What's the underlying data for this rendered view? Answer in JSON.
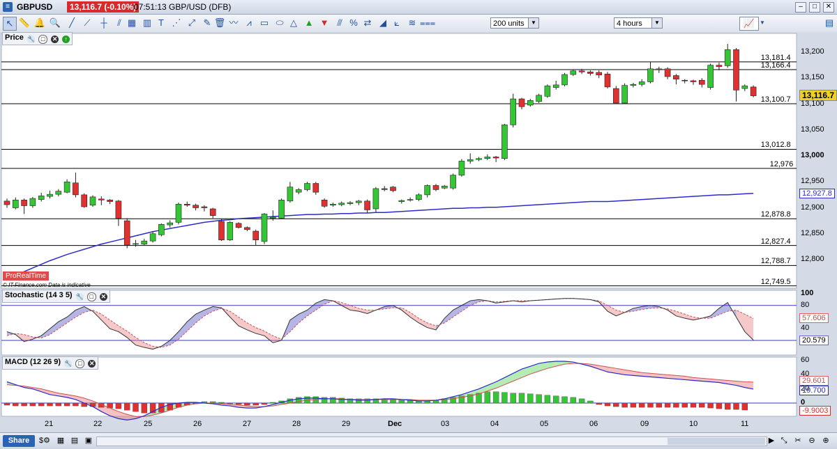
{
  "titlebar": {
    "symbol": "GBPUSD",
    "price": "13,116.7 (-0.10%)",
    "info": "07:51:13 GBP/USD (DFB)",
    "minimize": "–",
    "maximize": "□",
    "close": "✕"
  },
  "toolbar": {
    "units": "200 units",
    "timeframe": "4 hours"
  },
  "panels": {
    "price": {
      "label": "Price"
    },
    "stochastic": {
      "label": "Stochastic (14 3 5)"
    },
    "macd": {
      "label": "MACD (12 26 9)"
    }
  },
  "price_axis": [
    "13,200",
    "13,150",
    "13,100",
    "13,050",
    "13,000",
    "12,950",
    "12,900",
    "12,850",
    "12,800"
  ],
  "levels": [
    "13,181.4",
    "13,166.4",
    "13,100.7",
    "13,012.8",
    "12,976",
    "12,878.8",
    "12,827.4",
    "12,788.7",
    "12,749.5"
  ],
  "badges": {
    "last": "13,116.7",
    "ma": "12,927.8",
    "stoch_sig": "57.606",
    "stoch_k": "20.579",
    "macd1": "29.601",
    "macd2": "19.700",
    "macd3": "-9.9003"
  },
  "stoch_axis": [
    "100",
    "80",
    "40"
  ],
  "macd_axis": [
    "60",
    "40",
    "20",
    "0"
  ],
  "xlabels": [
    "21",
    "22",
    "25",
    "26",
    "27",
    "28",
    "29",
    "Dec",
    "03",
    "04",
    "05",
    "06",
    "09",
    "10",
    "11"
  ],
  "watermark": {
    "brand": "ProRealTime",
    "credit": "© IT-Finance.com  Data is indicative"
  },
  "status": {
    "share": "Share"
  },
  "colors": {
    "up": "#35c635",
    "down": "#e03030",
    "ma": "#2b2bcc",
    "level": "#000000"
  },
  "chart_data": {
    "type": "candlestick",
    "ylim": [
      12740,
      13220
    ],
    "candles": [
      {
        "o": 12913,
        "c": 12906,
        "h": 12918,
        "l": 12900
      },
      {
        "o": 12900,
        "c": 12915,
        "h": 12920,
        "l": 12897
      },
      {
        "o": 12915,
        "c": 12904,
        "h": 12918,
        "l": 12888
      },
      {
        "o": 12904,
        "c": 12918,
        "h": 12921,
        "l": 12900
      },
      {
        "o": 12916,
        "c": 12923,
        "h": 12929,
        "l": 12912
      },
      {
        "o": 12922,
        "c": 12926,
        "h": 12933,
        "l": 12918
      },
      {
        "o": 12926,
        "c": 12932,
        "h": 12936,
        "l": 12922
      },
      {
        "o": 12930,
        "c": 12950,
        "h": 12955,
        "l": 12928
      },
      {
        "o": 12948,
        "c": 12925,
        "h": 12968,
        "l": 12920
      },
      {
        "o": 12925,
        "c": 12902,
        "h": 12928,
        "l": 12900
      },
      {
        "o": 12905,
        "c": 12921,
        "h": 12924,
        "l": 12902
      },
      {
        "o": 12917,
        "c": 12915,
        "h": 12922,
        "l": 12905
      },
      {
        "o": 12915,
        "c": 12912,
        "h": 12917,
        "l": 12907
      },
      {
        "o": 12913,
        "c": 12880,
        "h": 12915,
        "l": 12865
      },
      {
        "o": 12875,
        "c": 12828,
        "h": 12880,
        "l": 12822
      },
      {
        "o": 12830,
        "c": 12831,
        "h": 12838,
        "l": 12825
      },
      {
        "o": 12830,
        "c": 12836,
        "h": 12840,
        "l": 12827
      },
      {
        "o": 12836,
        "c": 12850,
        "h": 12855,
        "l": 12833
      },
      {
        "o": 12848,
        "c": 12868,
        "h": 12870,
        "l": 12845
      },
      {
        "o": 12867,
        "c": 12871,
        "h": 12876,
        "l": 12862
      },
      {
        "o": 12872,
        "c": 12907,
        "h": 12910,
        "l": 12868
      },
      {
        "o": 12907,
        "c": 12905,
        "h": 12912,
        "l": 12902
      },
      {
        "o": 12905,
        "c": 12900,
        "h": 12908,
        "l": 12895
      },
      {
        "o": 12902,
        "c": 12900,
        "h": 12905,
        "l": 12893
      },
      {
        "o": 12898,
        "c": 12885,
        "h": 12900,
        "l": 12880
      },
      {
        "o": 12874,
        "c": 12838,
        "h": 12878,
        "l": 12836
      },
      {
        "o": 12838,
        "c": 12872,
        "h": 12874,
        "l": 12836
      },
      {
        "o": 12870,
        "c": 12862,
        "h": 12872,
        "l": 12860
      },
      {
        "o": 12862,
        "c": 12858,
        "h": 12864,
        "l": 12855
      },
      {
        "o": 12855,
        "c": 12838,
        "h": 12858,
        "l": 12827
      },
      {
        "o": 12835,
        "c": 12888,
        "h": 12890,
        "l": 12830
      },
      {
        "o": 12880,
        "c": 12882,
        "h": 12895,
        "l": 12875
      },
      {
        "o": 12880,
        "c": 12915,
        "h": 12918,
        "l": 12878
      },
      {
        "o": 12913,
        "c": 12940,
        "h": 12950,
        "l": 12910
      },
      {
        "o": 12930,
        "c": 12935,
        "h": 12938,
        "l": 12926
      },
      {
        "o": 12935,
        "c": 12947,
        "h": 12950,
        "l": 12932
      },
      {
        "o": 12947,
        "c": 12930,
        "h": 12950,
        "l": 12925
      },
      {
        "o": 12915,
        "c": 12903,
        "h": 12918,
        "l": 12900
      },
      {
        "o": 12905,
        "c": 12907,
        "h": 12910,
        "l": 12902
      },
      {
        "o": 12906,
        "c": 12909,
        "h": 12912,
        "l": 12903
      },
      {
        "o": 12908,
        "c": 12910,
        "h": 12913,
        "l": 12905
      },
      {
        "o": 12910,
        "c": 12913,
        "h": 12915,
        "l": 12905
      },
      {
        "o": 12913,
        "c": 12896,
        "h": 12916,
        "l": 12890
      },
      {
        "o": 12898,
        "c": 12937,
        "h": 12940,
        "l": 12892
      },
      {
        "o": 12937,
        "c": 12935,
        "h": 12942,
        "l": 12932
      },
      {
        "o": 12940,
        "c": 12933,
        "h": 12942,
        "l": 12930
      },
      {
        "o": 12912,
        "c": 12914,
        "h": 12916,
        "l": 12908
      },
      {
        "o": 12915,
        "c": 12916,
        "h": 12920,
        "l": 12912
      },
      {
        "o": 12916,
        "c": 12925,
        "h": 12928,
        "l": 12913
      },
      {
        "o": 12925,
        "c": 12943,
        "h": 12945,
        "l": 12920
      },
      {
        "o": 12943,
        "c": 12935,
        "h": 12946,
        "l": 12932
      },
      {
        "o": 12938,
        "c": 12942,
        "h": 12944,
        "l": 12936
      },
      {
        "o": 12938,
        "c": 12963,
        "h": 12966,
        "l": 12935
      },
      {
        "o": 12963,
        "c": 12990,
        "h": 12994,
        "l": 12960
      },
      {
        "o": 12990,
        "c": 12993,
        "h": 13005,
        "l": 12985
      },
      {
        "o": 12993,
        "c": 12995,
        "h": 12998,
        "l": 12990
      },
      {
        "o": 12995,
        "c": 12998,
        "h": 13003,
        "l": 12992
      },
      {
        "o": 12998,
        "c": 12996,
        "h": 13000,
        "l": 12988
      },
      {
        "o": 12995,
        "c": 13060,
        "h": 13062,
        "l": 12992
      },
      {
        "o": 13060,
        "c": 13110,
        "h": 13120,
        "l": 13055
      },
      {
        "o": 13110,
        "c": 13095,
        "h": 13112,
        "l": 13090
      },
      {
        "o": 13098,
        "c": 13107,
        "h": 13110,
        "l": 13095
      },
      {
        "o": 13105,
        "c": 13117,
        "h": 13120,
        "l": 13102
      },
      {
        "o": 13115,
        "c": 13135,
        "h": 13138,
        "l": 13112
      },
      {
        "o": 13132,
        "c": 13137,
        "h": 13145,
        "l": 13128
      },
      {
        "o": 13137,
        "c": 13157,
        "h": 13160,
        "l": 13134
      },
      {
        "o": 13157,
        "c": 13164,
        "h": 13167,
        "l": 13154
      },
      {
        "o": 13164,
        "c": 13162,
        "h": 13168,
        "l": 13158
      },
      {
        "o": 13162,
        "c": 13159,
        "h": 13165,
        "l": 13155
      },
      {
        "o": 13161,
        "c": 13156,
        "h": 13165,
        "l": 13150
      },
      {
        "o": 13158,
        "c": 13133,
        "h": 13162,
        "l": 13130
      },
      {
        "o": 13130,
        "c": 13102,
        "h": 13135,
        "l": 13100
      },
      {
        "o": 13102,
        "c": 13136,
        "h": 13140,
        "l": 13100
      },
      {
        "o": 13136,
        "c": 13138,
        "h": 13141,
        "l": 13132
      },
      {
        "o": 13138,
        "c": 13143,
        "h": 13148,
        "l": 13134
      },
      {
        "o": 13143,
        "c": 13168,
        "h": 13182,
        "l": 13140
      },
      {
        "o": 13168,
        "c": 13166,
        "h": 13172,
        "l": 13160
      },
      {
        "o": 13168,
        "c": 13153,
        "h": 13171,
        "l": 13148
      },
      {
        "o": 13155,
        "c": 13148,
        "h": 13158,
        "l": 13138
      },
      {
        "o": 13146,
        "c": 13145,
        "h": 13148,
        "l": 13140
      },
      {
        "o": 13145,
        "c": 13143,
        "h": 13147,
        "l": 13137
      },
      {
        "o": 13146,
        "c": 13138,
        "h": 13150,
        "l": 13132
      },
      {
        "o": 13132,
        "c": 13175,
        "h": 13178,
        "l": 13128
      },
      {
        "o": 13175,
        "c": 13172,
        "h": 13180,
        "l": 13165
      },
      {
        "o": 13174,
        "c": 13205,
        "h": 13216,
        "l": 13170
      },
      {
        "o": 13205,
        "c": 13127,
        "h": 13208,
        "l": 13105
      },
      {
        "o": 13130,
        "c": 13135,
        "h": 13138,
        "l": 13125
      },
      {
        "o": 13133,
        "c": 13116,
        "h": 13136,
        "l": 13113
      }
    ],
    "ma": [
      12763,
      12770,
      12777,
      12784,
      12791,
      12798,
      12804,
      12810,
      12815,
      12820,
      12825,
      12830,
      12834,
      12838,
      12842,
      12846,
      12850,
      12854,
      12857,
      12860,
      12863,
      12866,
      12869,
      12872,
      12874,
      12876,
      12877,
      12879,
      12880,
      12881,
      12882,
      12883,
      12884,
      12885,
      12886,
      12887,
      12887,
      12888,
      12888,
      12889,
      12889,
      12890,
      12890,
      12891,
      12891,
      12892,
      12893,
      12894,
      12895,
      12896,
      12897,
      12898,
      12899,
      12899,
      12900,
      12900,
      12901,
      12901,
      12902,
      12903,
      12904,
      12905,
      12906,
      12907,
      12908,
      12909,
      12910,
      12911,
      12912,
      12912,
      12912,
      12913,
      12914,
      12915,
      12916,
      12917,
      12918,
      12919,
      12920,
      12921,
      12922,
      12923,
      12924,
      12925,
      12925,
      12926,
      12927,
      12927.8
    ],
    "stoch_k": [
      35,
      30,
      18,
      22,
      28,
      40,
      52,
      60,
      72,
      78,
      70,
      55,
      40,
      35,
      25,
      12,
      8,
      5,
      10,
      20,
      35,
      52,
      65,
      72,
      78,
      76,
      60,
      45,
      38,
      32,
      28,
      16,
      20,
      55,
      65,
      72,
      84,
      90,
      88,
      80,
      72,
      70,
      66,
      72,
      78,
      80,
      72,
      60,
      50,
      42,
      38,
      58,
      72,
      80,
      88,
      90,
      88,
      84,
      86,
      88,
      86,
      88,
      89,
      90,
      91,
      92,
      92,
      91,
      90,
      86,
      70,
      62,
      68,
      75,
      78,
      80,
      78,
      72,
      62,
      58,
      55,
      58,
      62,
      75,
      85,
      60,
      35,
      20.579
    ],
    "stoch_d": [
      28,
      32,
      30,
      26,
      24,
      30,
      40,
      50,
      60,
      68,
      72,
      65,
      55,
      45,
      36,
      25,
      16,
      10,
      8,
      12,
      22,
      36,
      50,
      62,
      70,
      75,
      70,
      60,
      50,
      42,
      36,
      28,
      22,
      35,
      50,
      62,
      72,
      82,
      88,
      85,
      80,
      75,
      72,
      72,
      74,
      76,
      76,
      68,
      58,
      50,
      45,
      50,
      60,
      70,
      80,
      86,
      88,
      86,
      87,
      88,
      88,
      88,
      89,
      90,
      91,
      92,
      92,
      91,
      90,
      88,
      80,
      72,
      68,
      70,
      73,
      75,
      76,
      74,
      70,
      65,
      60,
      58,
      58,
      64,
      70,
      72,
      65,
      57.606
    ],
    "macd": [
      30,
      26,
      22,
      20,
      16,
      12,
      10,
      8,
      5,
      0,
      -5,
      -12,
      -18,
      -22,
      -24,
      -22,
      -18,
      -12,
      -6,
      -2,
      0,
      1,
      1,
      0,
      -1,
      -3,
      -4,
      -6,
      -7,
      -7,
      -5,
      -2,
      1,
      4,
      6,
      7,
      7,
      6,
      6,
      5,
      5,
      4,
      4,
      5,
      6,
      6,
      5,
      4,
      3,
      3,
      4,
      6,
      9,
      12,
      16,
      20,
      25,
      30,
      36,
      42,
      48,
      52,
      56,
      58,
      59,
      59,
      58,
      55,
      52,
      48,
      44,
      42,
      40,
      39,
      38,
      37,
      36,
      35,
      34,
      33,
      32,
      31,
      30,
      29,
      27,
      25,
      22,
      19.7
    ],
    "macd_signal": [
      26,
      25,
      24,
      22,
      20,
      17,
      14,
      12,
      10,
      7,
      3,
      -2,
      -7,
      -12,
      -16,
      -19,
      -19,
      -17,
      -14,
      -10,
      -6,
      -3,
      -1,
      0,
      0,
      -1,
      -2,
      -3,
      -4,
      -5,
      -5,
      -4,
      -2,
      0,
      2,
      4,
      5,
      6,
      6,
      6,
      5,
      5,
      5,
      5,
      5,
      5,
      5,
      5,
      4,
      4,
      4,
      5,
      6,
      8,
      10,
      13,
      17,
      21,
      26,
      31,
      36,
      41,
      45,
      49,
      52,
      55,
      56,
      56,
      55,
      53,
      51,
      49,
      47,
      45,
      43,
      42,
      41,
      40,
      39,
      38,
      36,
      35,
      34,
      33,
      32,
      31,
      30,
      29.601
    ],
    "macd_hist": [
      -3,
      -4,
      -4,
      -4,
      -4,
      -4,
      -4,
      -4,
      -4,
      -5,
      -5,
      -6,
      -7,
      -8,
      -10,
      -12,
      -14,
      -14,
      -13,
      -10,
      -6,
      -3,
      -1,
      2,
      2,
      1,
      -1,
      -2,
      -3,
      -3,
      -2,
      1,
      3,
      6,
      8,
      9,
      9,
      8,
      8,
      7,
      6,
      6,
      6,
      6,
      6,
      5,
      4,
      4,
      3,
      3,
      4,
      6,
      8,
      10,
      12,
      14,
      16,
      16,
      15,
      14,
      14,
      13,
      12,
      11,
      10,
      9,
      8,
      6,
      3,
      -2,
      -4,
      -5,
      -6,
      -6,
      -6,
      -6,
      -6,
      -6,
      -6,
      -6,
      -6,
      -6,
      -7,
      -8,
      -9,
      -9,
      -9.9003
    ]
  }
}
